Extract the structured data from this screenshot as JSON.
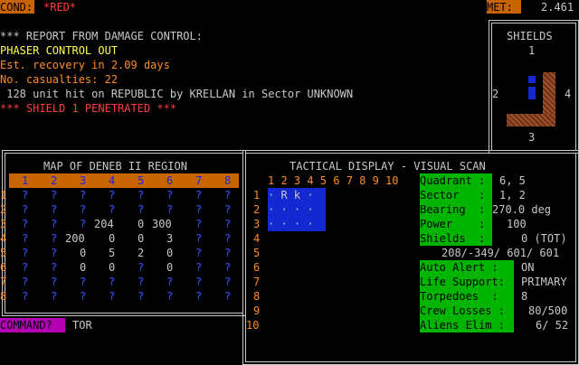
{
  "header": {
    "cond_label": "COND:",
    "cond_value": "*RED*",
    "met_label": "MET:",
    "met_value": "2.461"
  },
  "report": {
    "lines": [
      "*** REPORT FROM DAMAGE CONTROL:",
      "PHASER CONTROL OUT",
      "Est. recovery in 2.09 days",
      "No. casualties: 22",
      " 128 unit hit on REPUBLIC by KRELLAN in Sector UNKNOWN",
      "*** SHIELD 1 PENETRATED ***"
    ]
  },
  "shields": {
    "title": "SHIELDS",
    "n1": "1",
    "n2": "2",
    "n3": "3",
    "n4": "4"
  },
  "map": {
    "title": "MAP OF DENEB II REGION",
    "cols": [
      "1",
      "2",
      "3",
      "4",
      "5",
      "6",
      "7",
      "8"
    ],
    "rows": [
      [
        "?",
        "?",
        "?",
        "?",
        "?",
        "?",
        "?",
        "?"
      ],
      [
        "?",
        "?",
        "?",
        "?",
        "?",
        "?",
        "?",
        "?"
      ],
      [
        "?",
        "?",
        "?",
        "204",
        "0",
        "300",
        "?",
        "?"
      ],
      [
        "?",
        "?",
        "200",
        "0",
        "0",
        "3",
        "?",
        "?"
      ],
      [
        "?",
        "?",
        "0",
        "5",
        "2",
        "0",
        "?",
        "?"
      ],
      [
        "?",
        "?",
        "0",
        "0",
        "?",
        "0",
        "?",
        "?"
      ],
      [
        "?",
        "?",
        "?",
        "?",
        "?",
        "?",
        "?",
        "?"
      ],
      [
        "?",
        "?",
        "?",
        "?",
        "?",
        "?",
        "?",
        "?"
      ]
    ]
  },
  "command": {
    "label": "COMMAND?",
    "value": "TOR"
  },
  "tactical": {
    "title": "TACTICAL DISPLAY - VISUAL SCAN",
    "col_header": "1 2 3 4 5 6 7 8 9 10",
    "row_numbers": [
      "1",
      "2",
      "3",
      "4",
      "5",
      "6",
      "7",
      "8",
      "9",
      "10"
    ],
    "scan_rows": [
      "· R k ·",
      "· · · ·",
      "· · · ·"
    ]
  },
  "status": {
    "quadrant_label": "Quadrant :",
    "quadrant_value": "6, 5",
    "sector_label": "Sector   :",
    "sector_value": "1, 2",
    "bearing_label": "Bearing  :",
    "bearing_value": "270.0 deg",
    "power_label": "Power    :",
    "power_value": "100",
    "shields_label": "Shields  :",
    "shields_value": "0 (TOT)",
    "shield_line": "208/-349/ 601/ 601",
    "auto_alert_label": "Auto Alert :",
    "auto_alert_value": "ON",
    "life_support_label": "Life Support:",
    "life_support_value": "PRIMARY",
    "torpedoes_label": "Torpedoes  :",
    "torpedoes_value": "8",
    "crew_losses_label": "Crew Losses :",
    "crew_losses_value": "80/500",
    "aliens_label": "Aliens Elim :",
    "aliens_value": "6/ 52"
  },
  "colors": {
    "orange": "#c86400",
    "green": "#00b400",
    "blue": "#1428d2",
    "red": "#ff3c3c",
    "yellow": "#ffff50"
  }
}
